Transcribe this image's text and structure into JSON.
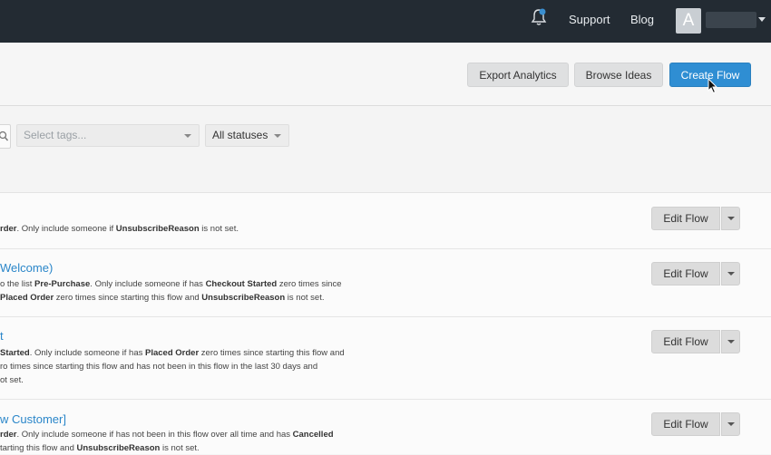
{
  "topbar": {
    "support_label": "Support",
    "blog_label": "Blog",
    "avatar_letter": "A",
    "background": "#232b33"
  },
  "header": {
    "export_label": "Export Analytics",
    "browse_label": "Browse Ideas",
    "create_label": "Create Flow",
    "accent": "#2f8ed3"
  },
  "filters": {
    "tags_placeholder": "Select tags...",
    "status_value": "All statuses"
  },
  "flows": [
    {
      "title": "",
      "desc_lines": [
        [
          {
            "t": "rder",
            "b": true
          },
          {
            "t": ". Only include someone if "
          },
          {
            "t": "UnsubscribeReason",
            "b": true
          },
          {
            "t": " is not set."
          }
        ]
      ],
      "edit_label": "Edit Flow"
    },
    {
      "title": "Welcome)",
      "desc_lines": [
        [
          {
            "t": "o the list "
          },
          {
            "t": "Pre-Purchase",
            "b": true
          },
          {
            "t": ". Only include someone if has "
          },
          {
            "t": "Checkout Started",
            "b": true
          },
          {
            "t": " zero times since"
          }
        ],
        [
          {
            "t": "Placed Order",
            "b": true
          },
          {
            "t": " zero times since starting this flow and "
          },
          {
            "t": "UnsubscribeReason",
            "b": true
          },
          {
            "t": " is not set."
          }
        ]
      ],
      "edit_label": "Edit Flow"
    },
    {
      "title": "t",
      "desc_lines": [
        [
          {
            "t": "Started",
            "b": true
          },
          {
            "t": ". Only include someone if has "
          },
          {
            "t": "Placed Order",
            "b": true
          },
          {
            "t": " zero times since starting this flow and"
          }
        ],
        [
          {
            "t": "ro times since starting this flow and has not been in this flow in the last 30 days and"
          }
        ],
        [
          {
            "t": "ot set."
          }
        ]
      ],
      "edit_label": "Edit Flow"
    },
    {
      "title": "w Customer]",
      "desc_lines": [
        [
          {
            "t": "rder",
            "b": true
          },
          {
            "t": ". Only include someone if has not been in this flow over all time and has "
          },
          {
            "t": "Cancelled",
            "b": true
          }
        ],
        [
          {
            "t": "tarting this flow and "
          },
          {
            "t": "UnsubscribeReason",
            "b": true
          },
          {
            "t": " is not set."
          }
        ]
      ],
      "edit_label": "Edit Flow"
    }
  ]
}
